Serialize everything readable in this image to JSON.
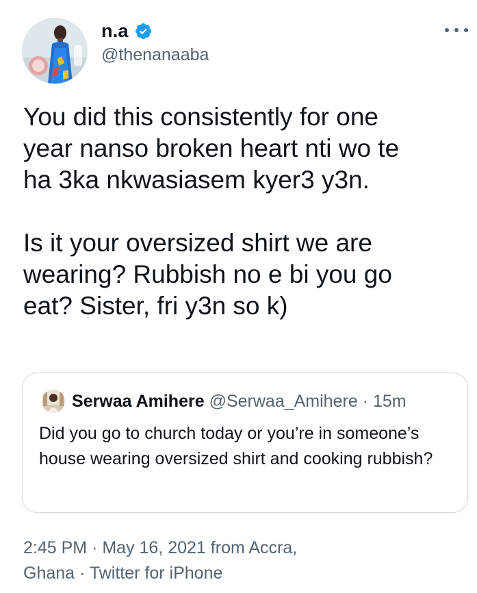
{
  "author": {
    "display_name": "n.a",
    "handle": "@thenanaaba",
    "verified": true,
    "avatar_icon": "profile-photo-woman-blue-dress"
  },
  "tweet": {
    "paragraphs": [
      "You did this consistently for one\nyear nanso broken heart nti wo te\nha 3ka nkwasiasem kyer3 y3n.",
      "Is it your oversized shirt we are\nwearing? Rubbish no e bi you go\neat? Sister, fri y3n so k)"
    ]
  },
  "quoted_tweet": {
    "display_name": "Serwaa Amihere",
    "handle": "@Serwaa_Amihere",
    "separator": "·",
    "time": "15m",
    "text": "Did you go to church today or you’re in someone’s house wearing oversized shirt and cooking rubbish?"
  },
  "meta": {
    "time": "2:45 PM",
    "date": "May 16, 2021",
    "location_prefix": "from Accra,",
    "location_suffix": "Ghana",
    "separator": "·",
    "source": "Twitter for iPhone"
  },
  "colors": {
    "text_primary": "#0f1419",
    "text_secondary": "#536471",
    "verified_blue": "#1d9bf0",
    "border": "#cfd9de"
  }
}
